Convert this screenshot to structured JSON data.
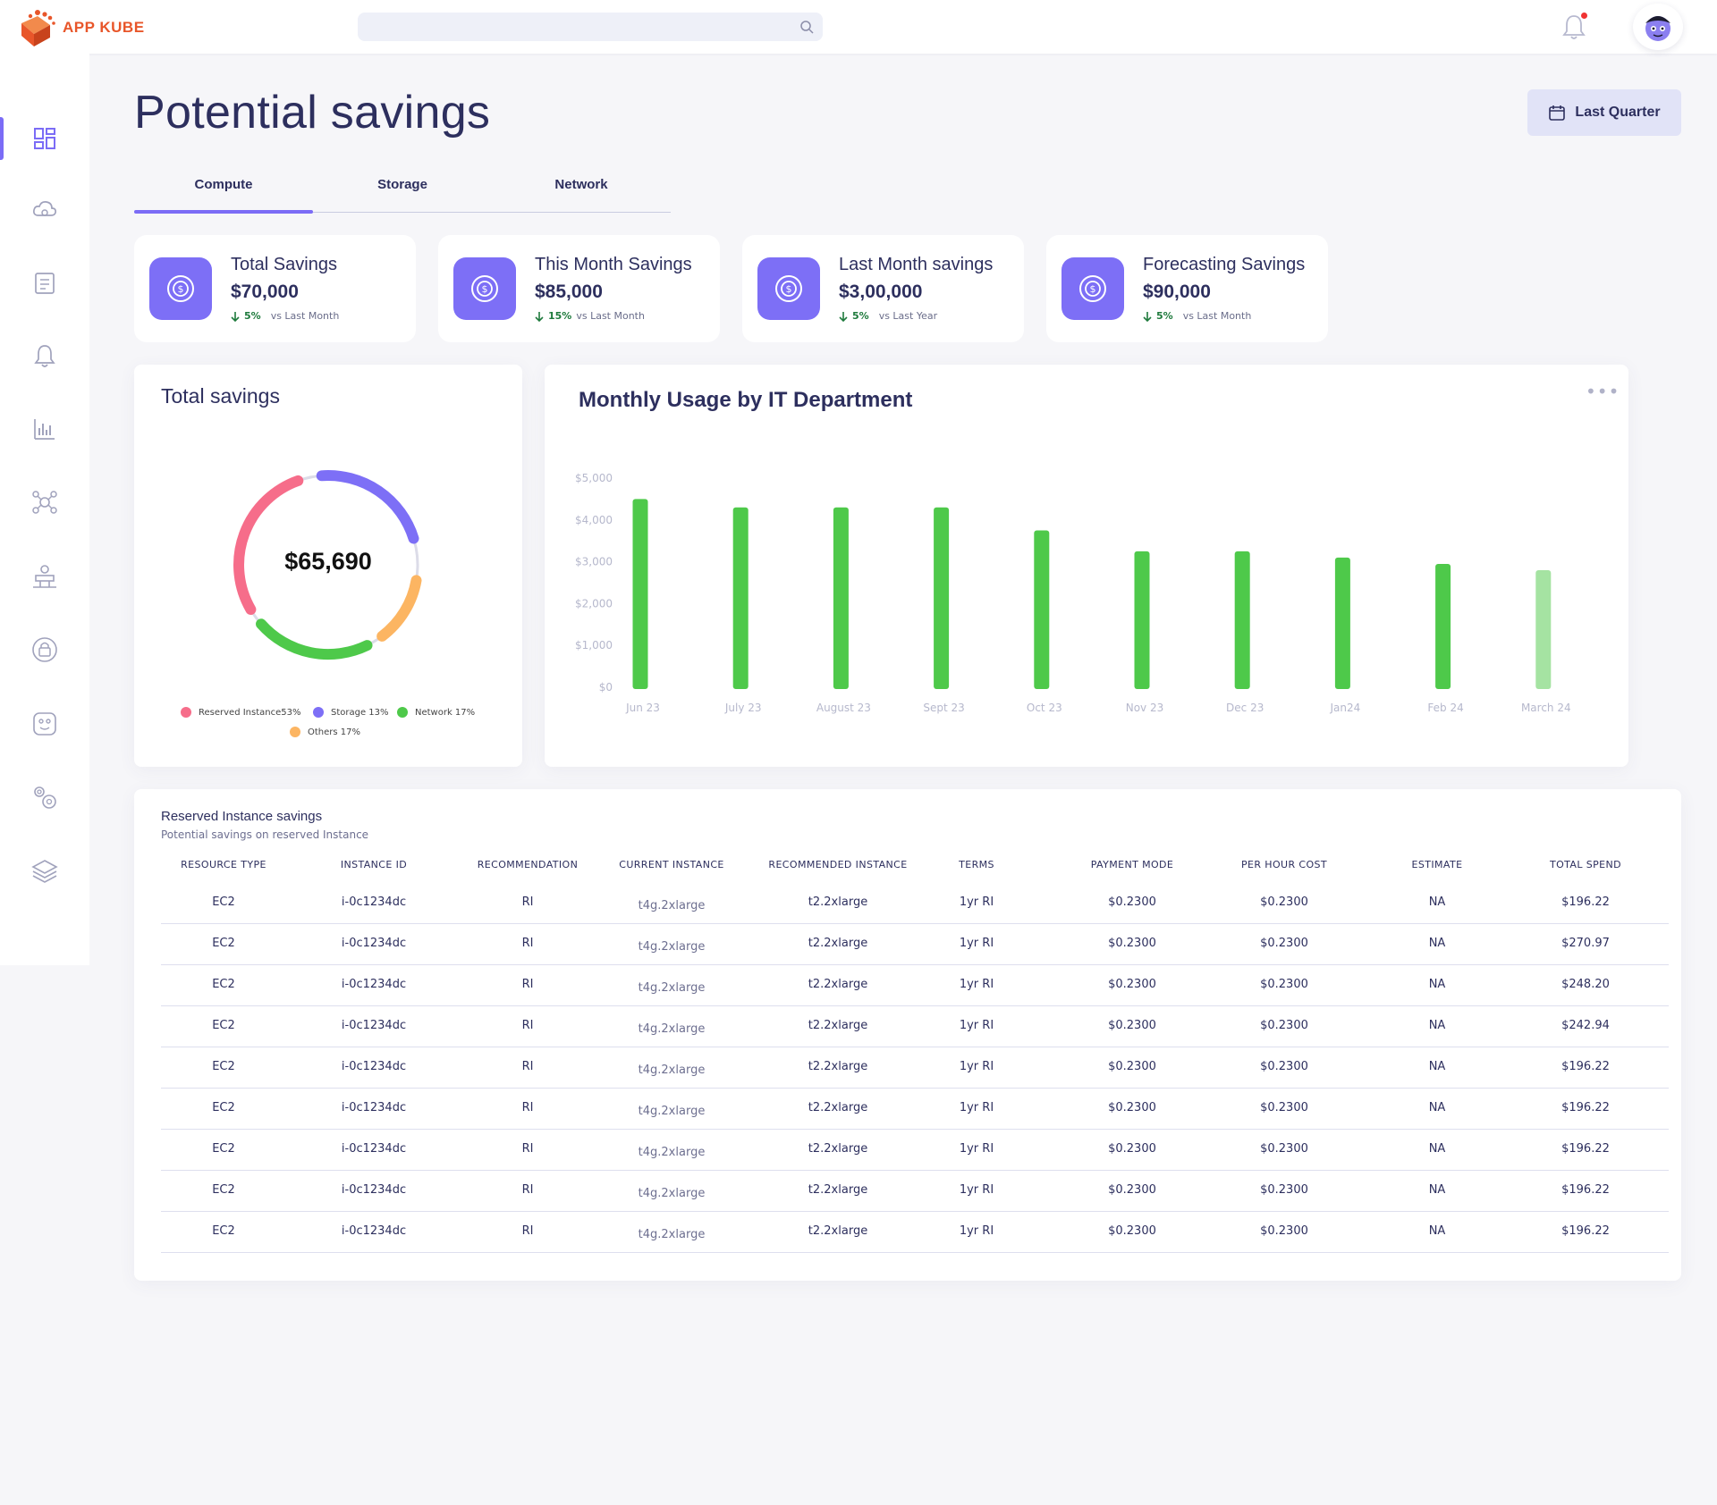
{
  "app": {
    "name": "APP KUBE"
  },
  "header": {
    "search_placeholder": ""
  },
  "page": {
    "title": "Potential savings",
    "date_filter": "Last Quarter"
  },
  "tabs": [
    {
      "label": "Compute"
    },
    {
      "label": "Storage"
    },
    {
      "label": "Network"
    }
  ],
  "kpis": [
    {
      "label": "Total Savings",
      "value": "$70,000",
      "delta": "5%",
      "compare": "vs Last Month"
    },
    {
      "label": "This Month Savings",
      "value": "$85,000",
      "delta": "15%",
      "compare": "vs Last Month"
    },
    {
      "label": "Last Month savings",
      "value": "$3,00,000",
      "delta": "5%",
      "compare": "vs Last Year"
    },
    {
      "label": "Forecasting Savings",
      "value": "$90,000",
      "delta": "5%",
      "compare": "vs Last Month"
    }
  ],
  "donut": {
    "title": "Total savings",
    "center_value": "$65,690",
    "legend": [
      {
        "label": "Reserved Instance53%",
        "color": "#f66d8a"
      },
      {
        "label": "Storage 13%",
        "color": "#7d6ff6"
      },
      {
        "label": "Network 17%",
        "color": "#4ec94a"
      },
      {
        "label": "Others  17%",
        "color": "#fcb562"
      }
    ]
  },
  "chart_data": {
    "type": "bar",
    "title": "Monthly Usage by IT Department",
    "categories": [
      "Jun 23",
      "July 23",
      "August 23",
      "Sept 23",
      "Oct 23",
      "Nov 23",
      "Dec 23",
      "Jan24",
      "Feb 24",
      "March 24"
    ],
    "values": [
      4500,
      4300,
      4300,
      4300,
      3750,
      3250,
      3250,
      3100,
      2950,
      2800
    ],
    "yticks": [
      "$5,000",
      "$4,000",
      "$3,000",
      "$2,000",
      "$1,000",
      "$0"
    ],
    "ylim": [
      0,
      5000
    ],
    "colors": {
      "bar": "#4ec94a",
      "last_bar": "#a5e3a2"
    }
  },
  "table": {
    "title": "Reserved Instance savings",
    "subtitle": "Potential savings on reserved Instance",
    "columns": [
      "RESOURCE TYPE",
      "INSTANCE ID",
      "RECOMMENDATION",
      "CURRENT INSTANCE",
      "RECOMMENDED INSTANCE",
      "TERMS",
      "PAYMENT MODE",
      "PER HOUR COST",
      "ESTIMATE",
      "TOTAL SPEND"
    ],
    "rows": [
      [
        "EC2",
        "i-0c1234dc",
        "RI",
        "t4g.2xlarge",
        "t2.2xlarge",
        "1yr  RI",
        "$0.2300",
        "$0.2300",
        "NA",
        "$196.22"
      ],
      [
        "EC2",
        "i-0c1234dc",
        "RI",
        "t4g.2xlarge",
        "t2.2xlarge",
        "1yr  RI",
        "$0.2300",
        "$0.2300",
        "NA",
        "$270.97"
      ],
      [
        "EC2",
        "i-0c1234dc",
        "RI",
        "t4g.2xlarge",
        "t2.2xlarge",
        "1yr  RI",
        "$0.2300",
        "$0.2300",
        "NA",
        "$248.20"
      ],
      [
        "EC2",
        "i-0c1234dc",
        "RI",
        "t4g.2xlarge",
        "t2.2xlarge",
        "1yr  RI",
        "$0.2300",
        "$0.2300",
        "NA",
        "$242.94"
      ],
      [
        "EC2",
        "i-0c1234dc",
        "RI",
        "t4g.2xlarge",
        "t2.2xlarge",
        "1yr  RI",
        "$0.2300",
        "$0.2300",
        "NA",
        "$196.22"
      ],
      [
        "EC2",
        "i-0c1234dc",
        "RI",
        "t4g.2xlarge",
        "t2.2xlarge",
        "1yr  RI",
        "$0.2300",
        "$0.2300",
        "NA",
        "$196.22"
      ],
      [
        "EC2",
        "i-0c1234dc",
        "RI",
        "t4g.2xlarge",
        "t2.2xlarge",
        "1yr  RI",
        "$0.2300",
        "$0.2300",
        "NA",
        "$196.22"
      ],
      [
        "EC2",
        "i-0c1234dc",
        "RI",
        "t4g.2xlarge",
        "t2.2xlarge",
        "1yr  RI",
        "$0.2300",
        "$0.2300",
        "NA",
        "$196.22"
      ],
      [
        "EC2",
        "i-0c1234dc",
        "RI",
        "t4g.2xlarge",
        "t2.2xlarge",
        "1yr  RI",
        "$0.2300",
        "$0.2300",
        "NA",
        "$196.22"
      ]
    ]
  },
  "colors": {
    "accent": "#7b6cf6",
    "text": "#2d2f5e",
    "positive": "#1e7a3c"
  },
  "icons": [
    "dashboard-icon",
    "cloud-icon",
    "document-icon",
    "alert-bell-icon",
    "report-chart-icon",
    "network-icon",
    "infra-icon",
    "security-icon",
    "integration-icon",
    "settings-icon",
    "layers-icon"
  ]
}
